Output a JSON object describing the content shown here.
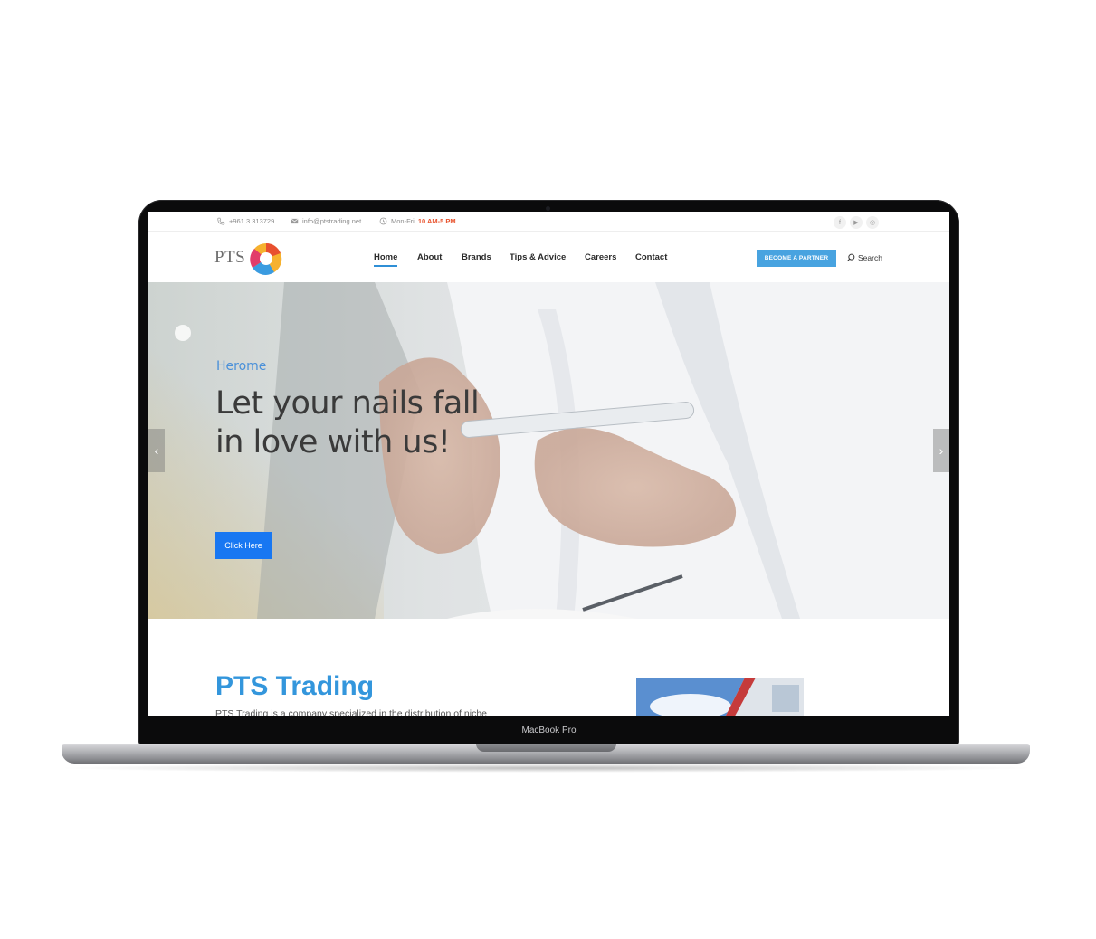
{
  "device": {
    "label": "MacBook Pro"
  },
  "topbar": {
    "phone": "+961 3 313729",
    "email": "info@ptstrading.net",
    "hours_prefix": "Mon-Fri",
    "hours_value": "10 AM-5 PM",
    "social": [
      {
        "icon": "facebook-icon",
        "glyph": "f"
      },
      {
        "icon": "youtube-icon",
        "glyph": "▶"
      },
      {
        "icon": "instagram-icon",
        "glyph": "◎"
      }
    ]
  },
  "header": {
    "logo_text": "PTS",
    "nav": [
      "Home",
      "About",
      "Brands",
      "Tips & Advice",
      "Careers",
      "Contact"
    ],
    "active_nav": "Home",
    "partner_button": "BECOME A PARTNER",
    "search_label": "Search"
  },
  "hero": {
    "subtitle": "Herome",
    "title_line1": "Let your nails fall",
    "title_line2": "in love with us!",
    "cta": "Click Here",
    "prev_arrow": "‹",
    "next_arrow": "›"
  },
  "section": {
    "title": "PTS Trading",
    "text": "PTS Trading is a company specialized in the distribution of niche"
  },
  "colors": {
    "accent": "#48a3e0",
    "nav_underline": "#2f8fd6",
    "hours_accent": "#e8542f",
    "cta": "#1877f2",
    "section_title": "#3396dc"
  }
}
